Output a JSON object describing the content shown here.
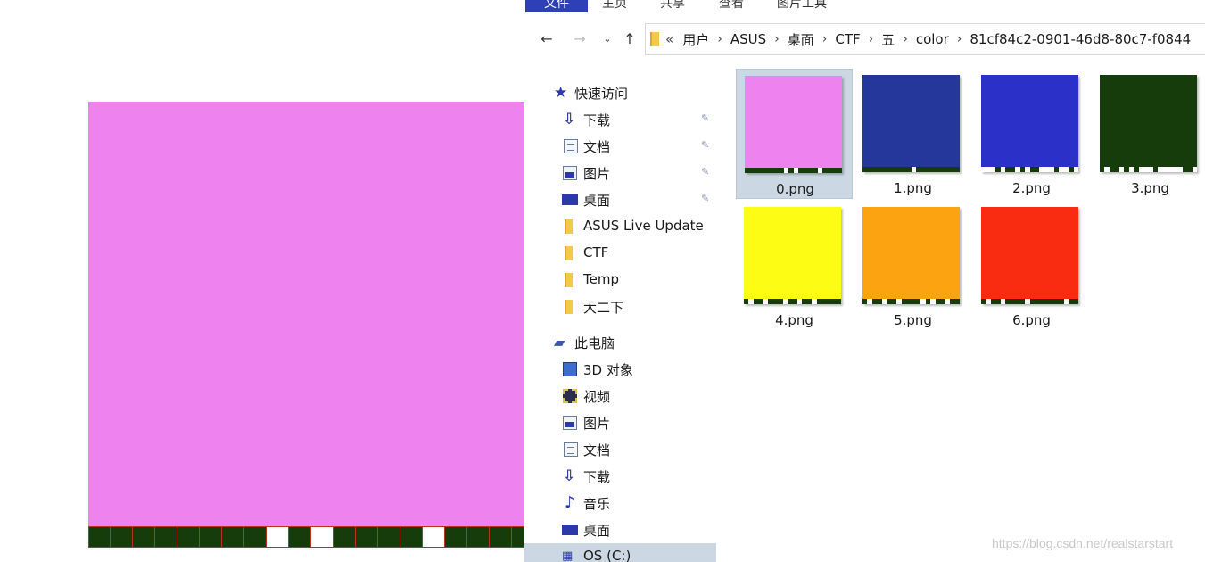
{
  "preview": {
    "color": "#ee82ee",
    "strip_dark": "#163c0c",
    "strip_light": "#ffffff",
    "strip_pattern": [
      0,
      0,
      0,
      0,
      0,
      0,
      0,
      0,
      1,
      0,
      1,
      0,
      0,
      0,
      0,
      1,
      0,
      0,
      0,
      0
    ]
  },
  "ribbon": {
    "tabs": [
      "文件",
      "主页",
      "共享",
      "查看",
      "图片工具"
    ]
  },
  "nav": {
    "back_icon": "arrow-left-icon",
    "forward_icon": "arrow-right-icon",
    "recent_icon": "chevron-down-icon",
    "up_icon": "arrow-up-icon"
  },
  "address": {
    "overflow": "«",
    "segments": [
      "用户",
      "ASUS",
      "桌面",
      "CTF",
      "五",
      "color",
      "81cf84c2-0901-46d8-80c7-f0844"
    ],
    "separator": "›"
  },
  "sidebar": {
    "quick_access": "快速访问",
    "quick_items": [
      {
        "label": "下载",
        "icon": "download-arrow-icon",
        "pinned": true
      },
      {
        "label": "文档",
        "icon": "document-icon",
        "pinned": true
      },
      {
        "label": "图片",
        "icon": "pictures-icon",
        "pinned": true
      },
      {
        "label": "桌面",
        "icon": "desktop-icon",
        "pinned": true
      },
      {
        "label": "ASUS Live Update",
        "icon": "folder-icon",
        "pinned": false
      },
      {
        "label": "CTF",
        "icon": "folder-icon",
        "pinned": false
      },
      {
        "label": "Temp",
        "icon": "folder-icon",
        "pinned": false
      },
      {
        "label": "大二下",
        "icon": "folder-icon",
        "pinned": false
      }
    ],
    "this_pc": "此电脑",
    "pc_items": [
      {
        "label": "3D 对象",
        "icon": "3d-objects-icon"
      },
      {
        "label": "视频",
        "icon": "video-icon"
      },
      {
        "label": "图片",
        "icon": "pictures-icon"
      },
      {
        "label": "文档",
        "icon": "document-icon"
      },
      {
        "label": "下载",
        "icon": "download-arrow-icon"
      },
      {
        "label": "音乐",
        "icon": "music-note-icon"
      },
      {
        "label": "桌面",
        "icon": "desktop-icon"
      },
      {
        "label": "OS (C:)",
        "icon": "drive-icon"
      }
    ]
  },
  "files": [
    {
      "name": "0.png",
      "color": "#ee82ee",
      "selected": true,
      "pattern": "#163c0c,#163c0c,#163c0c,#163c0c,#163c0c,#163c0c,#163c0c,#163c0c,#ffffff,#163c0c,#ffffff,#163c0c,#163c0c,#163c0c,#163c0c,#ffffff,#163c0c,#163c0c,#163c0c,#163c0c"
    },
    {
      "name": "1.png",
      "color": "#25379a",
      "selected": false,
      "pattern": "#163c0c,#163c0c,#163c0c,#163c0c,#163c0c,#163c0c,#163c0c,#163c0c,#163c0c,#163c0c,#ffffff,#163c0c,#163c0c,#163c0c,#163c0c,#163c0c,#163c0c,#163c0c,#163c0c,#163c0c"
    },
    {
      "name": "2.png",
      "color": "#2a30c8",
      "selected": false,
      "pattern": "#ffffff,#ffffff,#ffffff,#163c0c,#ffffff,#163c0c,#163c0c,#ffffff,#163c0c,#ffffff,#163c0c,#163c0c,#ffffff,#ffffff,#ffffff,#163c0c,#ffffff,#ffffff,#163c0c,#ffffff"
    },
    {
      "name": "3.png",
      "color": "#163c0c",
      "selected": false,
      "pattern": "#163c0c,#ffffff,#163c0c,#163c0c,#ffffff,#163c0c,#ffffff,#163c0c,#ffffff,#ffffff,#ffffff,#163c0c,#ffffff,#ffffff,#ffffff,#ffffff,#ffffff,#163c0c,#163c0c,#ffffff"
    },
    {
      "name": "4.png",
      "color": "#fcfc15",
      "selected": false,
      "pattern": "#163c0c,#ffffff,#163c0c,#163c0c,#ffffff,#163c0c,#163c0c,#163c0c,#ffffff,#163c0c,#163c0c,#ffffff,#163c0c,#163c0c,#ffffff,#163c0c,#163c0c,#163c0c,#163c0c,#163c0c"
    },
    {
      "name": "5.png",
      "color": "#fca312",
      "selected": false,
      "pattern": "#163c0c,#ffffff,#163c0c,#163c0c,#ffffff,#163c0c,#163c0c,#ffffff,#163c0c,#163c0c,#163c0c,#163c0c,#ffffff,#163c0c,#ffffff,#163c0c,#163c0c,#ffffff,#163c0c,#163c0c"
    },
    {
      "name": "6.png",
      "color": "#f92c12",
      "selected": false,
      "pattern": "#163c0c,#ffffff,#163c0c,#163c0c,#ffffff,#163c0c,#163c0c,#163c0c,#163c0c,#ffffff,#163c0c,#163c0c,#163c0c,#163c0c,#163c0c,#163c0c,#163c0c,#ffffff,#163c0c,#163c0c"
    }
  ],
  "watermark": "https://blog.csdn.net/realstarstart"
}
